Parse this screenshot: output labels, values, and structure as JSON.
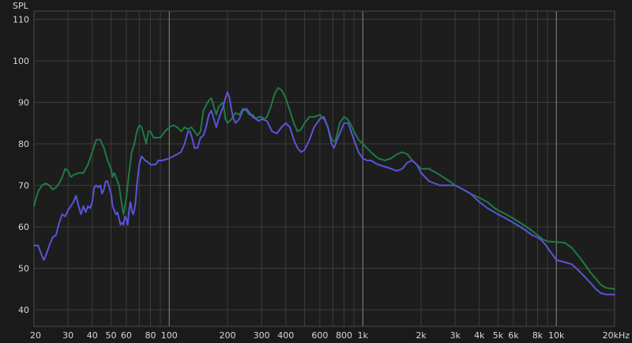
{
  "chart_data": {
    "type": "line",
    "ylabel": "SPL",
    "x_scale": "log",
    "xlim": [
      20,
      20000
    ],
    "ylim": [
      36,
      112
    ],
    "grid": true,
    "y_ticks": [
      {
        "value": 110,
        "label": "110"
      },
      {
        "value": 100,
        "label": "100"
      },
      {
        "value": 90,
        "label": "90"
      },
      {
        "value": 80,
        "label": "80"
      },
      {
        "value": 70,
        "label": "70"
      },
      {
        "value": 60,
        "label": "60"
      },
      {
        "value": 50,
        "label": "50"
      },
      {
        "value": 40,
        "label": "40"
      }
    ],
    "x_ticks": [
      {
        "value": 20,
        "label": "20"
      },
      {
        "value": 30,
        "label": "30"
      },
      {
        "value": 40,
        "label": "40"
      },
      {
        "value": 50,
        "label": "50"
      },
      {
        "value": 60,
        "label": "60"
      },
      {
        "value": 80,
        "label": "80"
      },
      {
        "value": 100,
        "label": "100"
      },
      {
        "value": 200,
        "label": "200"
      },
      {
        "value": 300,
        "label": "300"
      },
      {
        "value": 400,
        "label": "400"
      },
      {
        "value": 600,
        "label": "600"
      },
      {
        "value": 800,
        "label": "800"
      },
      {
        "value": 1000,
        "label": "1k"
      },
      {
        "value": 2000,
        "label": "2k"
      },
      {
        "value": 3000,
        "label": "3k"
      },
      {
        "value": 4000,
        "label": "4k"
      },
      {
        "value": 5000,
        "label": "5k"
      },
      {
        "value": 6000,
        "label": "6k"
      },
      {
        "value": 8000,
        "label": "8k"
      },
      {
        "value": 10000,
        "label": "10k"
      },
      {
        "value": 20000,
        "label": "20kHz"
      }
    ],
    "major_gridlines": [
      100,
      1000,
      10000
    ],
    "minor_gridlines": [
      30,
      40,
      50,
      60,
      70,
      80,
      90,
      200,
      300,
      400,
      500,
      600,
      700,
      800,
      900,
      2000,
      3000,
      4000,
      5000,
      6000,
      7000,
      8000,
      9000
    ],
    "colors": {
      "background": "#1a1a1a",
      "plot_background": "#1d1d1d",
      "grid_minor": "#3c3c3c",
      "grid_major": "#8a8a8a",
      "text": "#d8d8d8"
    },
    "series": [
      {
        "color": "#1f7a45",
        "points": [
          [
            20,
            65
          ],
          [
            21,
            68.5
          ],
          [
            22,
            70
          ],
          [
            23,
            70.5
          ],
          [
            24,
            70
          ],
          [
            25,
            69
          ],
          [
            26,
            69.5
          ],
          [
            27,
            70.5
          ],
          [
            28,
            72
          ],
          [
            29,
            74
          ],
          [
            30,
            73.5
          ],
          [
            31,
            72
          ],
          [
            32,
            72.5
          ],
          [
            34,
            73
          ],
          [
            36,
            73
          ],
          [
            38,
            75
          ],
          [
            40,
            78
          ],
          [
            42,
            81
          ],
          [
            44,
            81
          ],
          [
            46,
            79
          ],
          [
            48,
            76
          ],
          [
            50,
            74
          ],
          [
            51,
            72
          ],
          [
            52,
            73
          ],
          [
            53,
            72
          ],
          [
            55,
            70
          ],
          [
            57,
            65
          ],
          [
            58,
            63
          ],
          [
            60,
            67
          ],
          [
            62,
            73
          ],
          [
            64,
            78
          ],
          [
            66,
            80
          ],
          [
            68,
            83
          ],
          [
            70,
            84.5
          ],
          [
            72,
            84
          ],
          [
            74,
            82
          ],
          [
            76,
            80
          ],
          [
            78,
            83
          ],
          [
            80,
            83
          ],
          [
            83,
            81.5
          ],
          [
            86,
            81.5
          ],
          [
            90,
            81.5
          ],
          [
            95,
            83
          ],
          [
            100,
            84
          ],
          [
            105,
            84.5
          ],
          [
            110,
            84
          ],
          [
            115,
            83
          ],
          [
            120,
            84
          ],
          [
            125,
            83.5
          ],
          [
            130,
            84
          ],
          [
            135,
            83
          ],
          [
            140,
            82
          ],
          [
            145,
            83
          ],
          [
            150,
            88
          ],
          [
            160,
            90.5
          ],
          [
            165,
            91
          ],
          [
            170,
            89
          ],
          [
            175,
            87
          ],
          [
            180,
            89
          ],
          [
            190,
            90
          ],
          [
            195,
            86
          ],
          [
            200,
            85
          ],
          [
            210,
            86
          ],
          [
            220,
            87.5
          ],
          [
            230,
            87
          ],
          [
            240,
            88.5
          ],
          [
            250,
            88
          ],
          [
            260,
            87
          ],
          [
            270,
            87
          ],
          [
            280,
            86
          ],
          [
            290,
            86.5
          ],
          [
            300,
            86.5
          ],
          [
            310,
            86
          ],
          [
            320,
            86.5
          ],
          [
            335,
            89
          ],
          [
            350,
            92
          ],
          [
            365,
            93.5
          ],
          [
            380,
            93
          ],
          [
            400,
            91
          ],
          [
            420,
            88
          ],
          [
            440,
            85
          ],
          [
            460,
            83
          ],
          [
            480,
            83.5
          ],
          [
            500,
            85
          ],
          [
            530,
            86.5
          ],
          [
            560,
            86.5
          ],
          [
            600,
            87
          ],
          [
            630,
            86
          ],
          [
            660,
            84
          ],
          [
            690,
            81
          ],
          [
            720,
            80.5
          ],
          [
            760,
            85
          ],
          [
            800,
            86.5
          ],
          [
            830,
            86
          ],
          [
            860,
            85
          ],
          [
            900,
            83
          ],
          [
            950,
            81
          ],
          [
            1000,
            80
          ],
          [
            1050,
            79
          ],
          [
            1100,
            78
          ],
          [
            1200,
            76.5
          ],
          [
            1300,
            76
          ],
          [
            1400,
            76.5
          ],
          [
            1500,
            77.5
          ],
          [
            1600,
            78
          ],
          [
            1700,
            77.5
          ],
          [
            1800,
            76
          ],
          [
            1900,
            75
          ],
          [
            2000,
            74
          ],
          [
            2200,
            74
          ],
          [
            2500,
            72.5
          ],
          [
            2800,
            71
          ],
          [
            3000,
            70
          ],
          [
            3300,
            69
          ],
          [
            3600,
            68
          ],
          [
            4000,
            67
          ],
          [
            4400,
            66
          ],
          [
            4800,
            64.5
          ],
          [
            5000,
            64
          ],
          [
            5500,
            63
          ],
          [
            6000,
            62
          ],
          [
            6500,
            61
          ],
          [
            7000,
            60
          ],
          [
            7500,
            59
          ],
          [
            8000,
            58
          ],
          [
            8500,
            57
          ],
          [
            9000,
            56.5
          ],
          [
            10000,
            56.3
          ],
          [
            11000,
            56.2
          ],
          [
            12000,
            55
          ],
          [
            13000,
            53
          ],
          [
            14000,
            51
          ],
          [
            15000,
            49
          ],
          [
            16000,
            47.5
          ],
          [
            17000,
            46
          ],
          [
            18000,
            45.3
          ],
          [
            20000,
            45
          ]
        ]
      },
      {
        "color": "#5a54d8",
        "points": [
          [
            20,
            55.5
          ],
          [
            21,
            55.5
          ],
          [
            22,
            53
          ],
          [
            22.5,
            52
          ],
          [
            23,
            53
          ],
          [
            24,
            55.5
          ],
          [
            25,
            57.5
          ],
          [
            26,
            58
          ],
          [
            27,
            61
          ],
          [
            28,
            63
          ],
          [
            29,
            62.5
          ],
          [
            30,
            64
          ],
          [
            31,
            65
          ],
          [
            32,
            66
          ],
          [
            33,
            67.5
          ],
          [
            34,
            65
          ],
          [
            35,
            63
          ],
          [
            36,
            65
          ],
          [
            37,
            63.5
          ],
          [
            38,
            65
          ],
          [
            39,
            64.5
          ],
          [
            40,
            66
          ],
          [
            41,
            69.5
          ],
          [
            42,
            70
          ],
          [
            43,
            69.5
          ],
          [
            44,
            70
          ],
          [
            45,
            68
          ],
          [
            46,
            69
          ],
          [
            47,
            71
          ],
          [
            48,
            71
          ],
          [
            49,
            69.5
          ],
          [
            50,
            68
          ],
          [
            51,
            65
          ],
          [
            52,
            64
          ],
          [
            53,
            63
          ],
          [
            54,
            63.5
          ],
          [
            55,
            62
          ],
          [
            56,
            60.5
          ],
          [
            57,
            61
          ],
          [
            58,
            60.5
          ],
          [
            59,
            62.5
          ],
          [
            60,
            62
          ],
          [
            61,
            60.5
          ],
          [
            62,
            64
          ],
          [
            63,
            66
          ],
          [
            64,
            64
          ],
          [
            65,
            63
          ],
          [
            66,
            64
          ],
          [
            67,
            66
          ],
          [
            68,
            70
          ],
          [
            70,
            75
          ],
          [
            72,
            77
          ],
          [
            75,
            76
          ],
          [
            78,
            75.5
          ],
          [
            80,
            75
          ],
          [
            85,
            75
          ],
          [
            88,
            76
          ],
          [
            92,
            76
          ],
          [
            100,
            76.5
          ],
          [
            105,
            77
          ],
          [
            110,
            77.5
          ],
          [
            115,
            78
          ],
          [
            120,
            80
          ],
          [
            125,
            83
          ],
          [
            128,
            83
          ],
          [
            132,
            81
          ],
          [
            135,
            79
          ],
          [
            140,
            79
          ],
          [
            145,
            81.5
          ],
          [
            150,
            82
          ],
          [
            155,
            84
          ],
          [
            160,
            87
          ],
          [
            165,
            88
          ],
          [
            170,
            86
          ],
          [
            175,
            84
          ],
          [
            180,
            86
          ],
          [
            190,
            89
          ],
          [
            195,
            91
          ],
          [
            200,
            92.5
          ],
          [
            205,
            91
          ],
          [
            210,
            88
          ],
          [
            215,
            86
          ],
          [
            220,
            85
          ],
          [
            230,
            86
          ],
          [
            240,
            88
          ],
          [
            250,
            88.5
          ],
          [
            260,
            87.5
          ],
          [
            270,
            86.5
          ],
          [
            280,
            86
          ],
          [
            290,
            85.5
          ],
          [
            300,
            86
          ],
          [
            320,
            85.5
          ],
          [
            340,
            83
          ],
          [
            360,
            82.5
          ],
          [
            380,
            84
          ],
          [
            400,
            85
          ],
          [
            420,
            84
          ],
          [
            440,
            81
          ],
          [
            460,
            79
          ],
          [
            480,
            78
          ],
          [
            500,
            78.5
          ],
          [
            530,
            81
          ],
          [
            560,
            84
          ],
          [
            600,
            86
          ],
          [
            630,
            86.5
          ],
          [
            660,
            84
          ],
          [
            690,
            80
          ],
          [
            710,
            79
          ],
          [
            730,
            80.5
          ],
          [
            760,
            82.5
          ],
          [
            800,
            85
          ],
          [
            840,
            85
          ],
          [
            870,
            83
          ],
          [
            900,
            81
          ],
          [
            950,
            78
          ],
          [
            1000,
            76.5
          ],
          [
            1050,
            76
          ],
          [
            1100,
            76
          ],
          [
            1200,
            75
          ],
          [
            1300,
            74.5
          ],
          [
            1400,
            74
          ],
          [
            1500,
            73.5
          ],
          [
            1600,
            74
          ],
          [
            1700,
            75.5
          ],
          [
            1800,
            76
          ],
          [
            1900,
            75
          ],
          [
            2000,
            73
          ],
          [
            2200,
            71
          ],
          [
            2500,
            70
          ],
          [
            2800,
            70
          ],
          [
            3000,
            70
          ],
          [
            3300,
            69
          ],
          [
            3600,
            68
          ],
          [
            4000,
            66
          ],
          [
            4400,
            64.5
          ],
          [
            4800,
            63.5
          ],
          [
            5000,
            63
          ],
          [
            5500,
            62
          ],
          [
            6000,
            61
          ],
          [
            6500,
            60
          ],
          [
            7000,
            59
          ],
          [
            7500,
            58
          ],
          [
            8000,
            57.5
          ],
          [
            8500,
            56.5
          ],
          [
            9000,
            55
          ],
          [
            10000,
            52
          ],
          [
            11000,
            51.5
          ],
          [
            12000,
            51
          ],
          [
            13000,
            49.5
          ],
          [
            14000,
            48
          ],
          [
            15000,
            46.5
          ],
          [
            16000,
            45
          ],
          [
            17000,
            44
          ],
          [
            18000,
            43.7
          ],
          [
            20000,
            43.7
          ]
        ]
      }
    ]
  }
}
